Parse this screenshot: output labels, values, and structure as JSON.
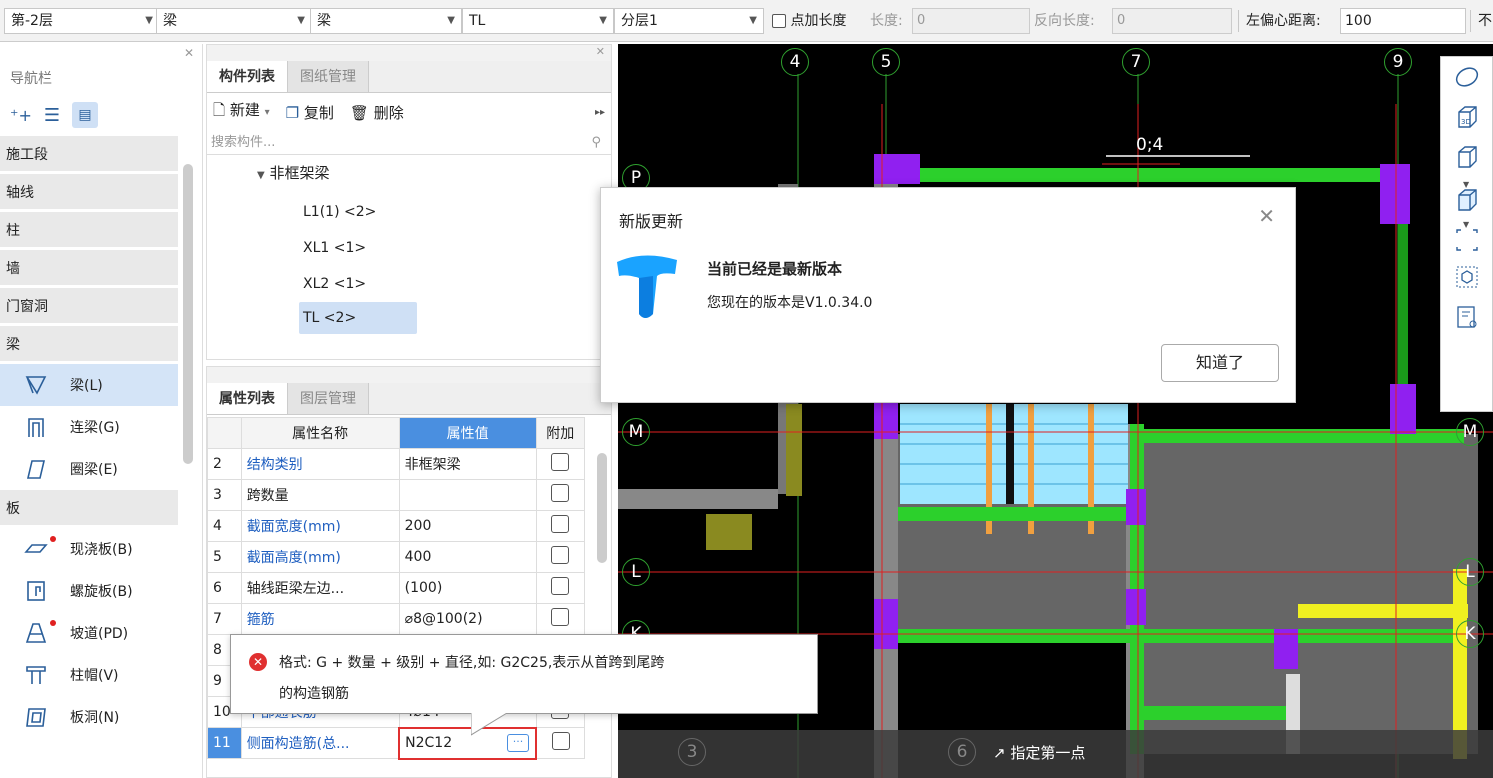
{
  "toolbar": {
    "floor": "第-2层",
    "type1": "梁",
    "type2": "梁",
    "component": "TL",
    "layer": "分层1",
    "add_length_label": "点加长度",
    "length_label": "长度:",
    "length_value": "0",
    "reverse_length_label": "反向长度:",
    "reverse_length_value": "0",
    "left_offset_label": "左偏心距离:",
    "left_offset_value": "100",
    "overflow_char": "不"
  },
  "nav": {
    "title": "导航栏",
    "categories": {
      "c1": "施工段",
      "c2": "轴线",
      "c3": "柱",
      "c4": "墙",
      "c5": "门窗洞",
      "c6": "梁",
      "c7": "板"
    },
    "beam_items": {
      "b1": "梁(L)",
      "b2": "连梁(G)",
      "b3": "圈梁(E)"
    },
    "slab_items": {
      "s1": "现浇板(B)",
      "s2": "螺旋板(B)",
      "s3": "坡道(PD)",
      "s4": "柱帽(V)",
      "s5": "板洞(N)"
    }
  },
  "component_panel": {
    "tab_list": "构件列表",
    "tab_drawings": "图纸管理",
    "new_label": "新建",
    "copy_label": "复制",
    "delete_label": "删除",
    "search_placeholder": "搜索构件...",
    "tree_group": "非框架梁",
    "tree_items": {
      "t1": "L1(1) <2>",
      "t2": "XL1 <1>",
      "t3": "XL2 <1>",
      "t4": "TL <2>"
    }
  },
  "props_panel": {
    "tab_props": "属性列表",
    "tab_layers": "图层管理",
    "col_name": "属性名称",
    "col_value": "属性值",
    "col_extra": "附加",
    "rows": {
      "r2": {
        "num": "2",
        "name": "结构类别",
        "value": "非框架梁"
      },
      "r3": {
        "num": "3",
        "name": "跨数量",
        "value": ""
      },
      "r4": {
        "num": "4",
        "name": "截面宽度(mm)",
        "value": "200"
      },
      "r5": {
        "num": "5",
        "name": "截面高度(mm)",
        "value": "400"
      },
      "r6": {
        "num": "6",
        "name": "轴线距梁左边...",
        "value": "(100)"
      },
      "r7": {
        "num": "7",
        "name": "箍筋",
        "value": "⌀8@100(2)"
      },
      "r8": {
        "num": "8",
        "name": "",
        "value": ""
      },
      "r9": {
        "num": "9",
        "name": "",
        "value": ""
      },
      "r10": {
        "num": "10",
        "name": "下部通长筋",
        "value": "4⌀14"
      },
      "r11": {
        "num": "11",
        "name": "侧面构造筋(总...",
        "value": "N2C12"
      }
    }
  },
  "tooltip": {
    "line1": "格式: G + 数量 + 级别 + 直径,如: G2C25,表示从首跨到尾跨",
    "line2": "的构造钢筋"
  },
  "dialog": {
    "title": "新版更新",
    "heading": "当前已经是最新版本",
    "version_text": "您现在的版本是V1.0.34.0",
    "ok_button": "知道了"
  },
  "canvas": {
    "axes_top": {
      "a": "4",
      "b": "5",
      "c": "7",
      "d": "9"
    },
    "axes_left": {
      "a": "P",
      "b": "M",
      "c": "L",
      "d": "K"
    },
    "axes_right": {
      "a": "M",
      "b": "L",
      "c": "K"
    },
    "dim_label": "0;4",
    "bottom_axes": {
      "a": "3",
      "b": "6"
    },
    "status_text": "指定第一点"
  }
}
